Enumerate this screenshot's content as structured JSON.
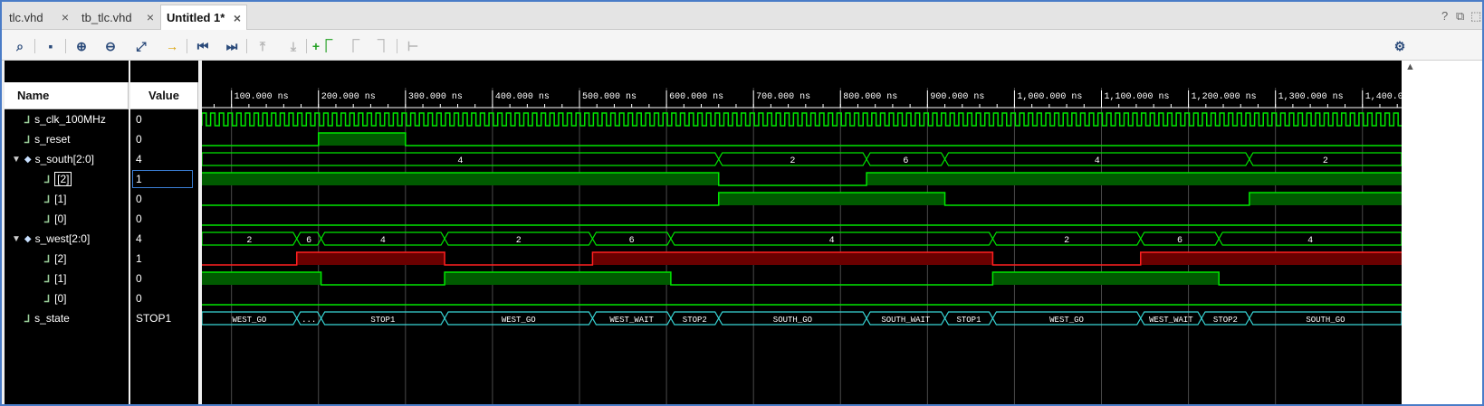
{
  "tabs": [
    {
      "label": "tlc.vhd",
      "close": "×",
      "active": false
    },
    {
      "label": "tb_tlc.vhd",
      "close": "×",
      "active": false
    },
    {
      "label": "Untitled 1*",
      "close": "×",
      "active": true
    }
  ],
  "window_controls": {
    "help": "?",
    "restore": "⧉",
    "maximize": "⬚"
  },
  "toolbar": [
    {
      "icon": "search-icon",
      "glyph": "⌕",
      "enabled": true
    },
    {
      "icon": "save-icon",
      "glyph": "▪",
      "enabled": true
    },
    {
      "icon": "zoom-in-icon",
      "glyph": "⊕",
      "enabled": true
    },
    {
      "icon": "zoom-out-icon",
      "glyph": "⊖",
      "enabled": true
    },
    {
      "icon": "zoom-fit-icon",
      "glyph": "⤢",
      "enabled": true
    },
    {
      "icon": "go-to-cursor-icon",
      "glyph": "→",
      "enabled": true
    },
    {
      "icon": "go-to-start-icon",
      "glyph": "⏮",
      "enabled": true
    },
    {
      "icon": "go-to-end-icon",
      "glyph": "⏭",
      "enabled": true
    },
    {
      "icon": "previous-transition-icon",
      "glyph": "⤒",
      "enabled": false
    },
    {
      "icon": "next-transition-icon",
      "glyph": "⤓",
      "enabled": false
    },
    {
      "icon": "add-marker-icon",
      "glyph": "+⎾",
      "enabled": true
    },
    {
      "icon": "previous-marker-icon",
      "glyph": "⎾",
      "enabled": false
    },
    {
      "icon": "next-marker-icon",
      "glyph": "⏋",
      "enabled": false
    },
    {
      "icon": "swap-cursors-icon",
      "glyph": "⊢",
      "enabled": false
    }
  ],
  "settings_icon": "⚙",
  "headers": {
    "name": "Name",
    "value": "Value"
  },
  "signals": [
    {
      "name": "s_clk_100MHz",
      "value": "0",
      "kind": "bit",
      "indent": 0
    },
    {
      "name": "s_reset",
      "value": "0",
      "kind": "bit",
      "indent": 0
    },
    {
      "name": "s_south[2:0]",
      "value": "4",
      "kind": "bus",
      "indent": 0
    },
    {
      "name": "[2]",
      "value": "1",
      "kind": "bit",
      "indent": 1,
      "selected": true
    },
    {
      "name": "[1]",
      "value": "0",
      "kind": "bit",
      "indent": 1
    },
    {
      "name": "[0]",
      "value": "0",
      "kind": "bit",
      "indent": 1
    },
    {
      "name": "s_west[2:0]",
      "value": "4",
      "kind": "bus",
      "indent": 0
    },
    {
      "name": "[2]",
      "value": "1",
      "kind": "bit",
      "indent": 1
    },
    {
      "name": "[1]",
      "value": "0",
      "kind": "bit",
      "indent": 1
    },
    {
      "name": "[0]",
      "value": "0",
      "kind": "bit",
      "indent": 1
    },
    {
      "name": "s_state",
      "value": "STOP1",
      "kind": "enum",
      "indent": 0
    }
  ],
  "time_axis": {
    "unit": "ns",
    "view_start_ns": 66,
    "view_end_ns": 1445,
    "labels": [
      {
        "t": 100,
        "label": "100.000 ns"
      },
      {
        "t": 200,
        "label": "200.000 ns"
      },
      {
        "t": 300,
        "label": "300.000 ns"
      },
      {
        "t": 400,
        "label": "400.000 ns"
      },
      {
        "t": 500,
        "label": "500.000 ns"
      },
      {
        "t": 600,
        "label": "600.000 ns"
      },
      {
        "t": 700,
        "label": "700.000 ns"
      },
      {
        "t": 800,
        "label": "800.000 ns"
      },
      {
        "t": 900,
        "label": "900.000 ns"
      },
      {
        "t": 1000,
        "label": "1,000.000 ns"
      },
      {
        "t": 1100,
        "label": "1,100.000 ns"
      },
      {
        "t": 1200,
        "label": "1,200.000 ns"
      },
      {
        "t": 1300,
        "label": "1,300.000 ns"
      },
      {
        "t": 1400,
        "label": "1,400.0"
      }
    ],
    "clock_period_ns": 10
  },
  "waves": {
    "reset": [
      [
        66,
        0
      ],
      [
        200,
        1
      ],
      [
        300,
        0
      ]
    ],
    "south_bus": [
      {
        "t0": 66,
        "t1": 660,
        "label": "4"
      },
      {
        "t0": 660,
        "t1": 830,
        "label": "2"
      },
      {
        "t0": 830,
        "t1": 920,
        "label": "6"
      },
      {
        "t0": 920,
        "t1": 1270,
        "label": "4"
      },
      {
        "t0": 1270,
        "t1": 1445,
        "label": "2"
      }
    ],
    "south_bits": [
      [
        [
          66,
          1
        ],
        [
          660,
          0
        ],
        [
          830,
          1
        ]
      ],
      [
        [
          66,
          0
        ],
        [
          660,
          1
        ],
        [
          920,
          0
        ],
        [
          1270,
          1
        ]
      ],
      [
        [
          66,
          0
        ]
      ]
    ],
    "west_bus": [
      {
        "t0": 66,
        "t1": 175,
        "label": "2"
      },
      {
        "t0": 175,
        "t1": 203,
        "label": "6"
      },
      {
        "t0": 203,
        "t1": 345,
        "label": "4"
      },
      {
        "t0": 345,
        "t1": 515,
        "label": "2"
      },
      {
        "t0": 515,
        "t1": 605,
        "label": "6"
      },
      {
        "t0": 605,
        "t1": 975,
        "label": "4"
      },
      {
        "t0": 975,
        "t1": 1145,
        "label": "2"
      },
      {
        "t0": 1145,
        "t1": 1235,
        "label": "6"
      },
      {
        "t0": 1235,
        "t1": 1445,
        "label": "4"
      }
    ],
    "west_bits": [
      [
        [
          66,
          0
        ],
        [
          175,
          1
        ],
        [
          345,
          0
        ],
        [
          515,
          1
        ],
        [
          975,
          0
        ],
        [
          1145,
          1
        ]
      ],
      [
        [
          66,
          1
        ],
        [
          203,
          0
        ],
        [
          345,
          1
        ],
        [
          605,
          0
        ],
        [
          975,
          1
        ],
        [
          1235,
          0
        ]
      ],
      [
        [
          66,
          0
        ]
      ]
    ],
    "state": [
      {
        "t0": 66,
        "t1": 175,
        "label": "WEST_GO"
      },
      {
        "t0": 175,
        "t1": 203,
        "label": "..."
      },
      {
        "t0": 203,
        "t1": 345,
        "label": "STOP1"
      },
      {
        "t0": 345,
        "t1": 515,
        "label": "WEST_GO"
      },
      {
        "t0": 515,
        "t1": 605,
        "label": "WEST_WAIT"
      },
      {
        "t0": 605,
        "t1": 660,
        "label": "STOP2"
      },
      {
        "t0": 660,
        "t1": 830,
        "label": "SOUTH_GO"
      },
      {
        "t0": 830,
        "t1": 920,
        "label": "SOUTH_WAIT"
      },
      {
        "t0": 920,
        "t1": 975,
        "label": "STOP1"
      },
      {
        "t0": 975,
        "t1": 1145,
        "label": "WEST_GO"
      },
      {
        "t0": 1145,
        "t1": 1215,
        "label": "WEST_WAIT"
      },
      {
        "t0": 1215,
        "t1": 1270,
        "label": "STOP2"
      },
      {
        "t0": 1270,
        "t1": 1445,
        "label": "SOUTH_GO"
      }
    ]
  },
  "colors": {
    "wave_green": "#00e600",
    "fill_green": "#005a00",
    "wave_red": "#ff2020",
    "fill_red": "#6a0000",
    "state_cyan": "#38d6d6",
    "grid": "#4a4a4a",
    "axis_white": "#ffffff"
  }
}
